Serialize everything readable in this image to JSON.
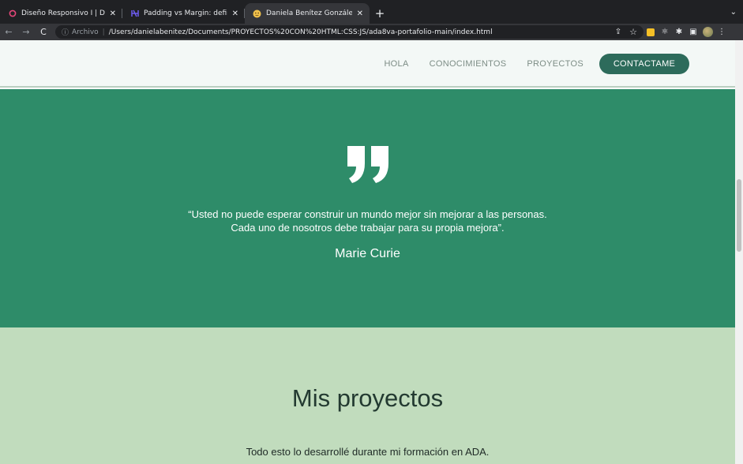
{
  "browser": {
    "tabs": [
      {
        "title": "Diseño Responsivo I | Desarroll",
        "favicon": "ring-icon",
        "color": "#e8477a"
      },
      {
        "title": "Padding vs Margin: definición,",
        "favicon": "h-logo-icon",
        "color": "#6d5cf0"
      },
      {
        "title": "Daniela Benítez González",
        "favicon": "emoji-icon",
        "color": "#f0c14b"
      }
    ],
    "new_tab": "+",
    "address": {
      "scheme": "Archivo",
      "url": "/Users/danielabenitez/Documents/PROYECTOS%20CON%20HTML:CSS:JS/ada8va-portafolio-main/index.html"
    }
  },
  "site": {
    "nav": {
      "links": [
        "HOLA",
        "CONOCIMIENTOS",
        "PROYECTOS"
      ],
      "cta": "CONTACTAME"
    },
    "quote": {
      "line1": "“Usted no puede esperar construir un mundo mejor sin mejorar a las personas.",
      "line2": "Cada uno de nosotros debe trabajar para su propia mejora”.",
      "author": "Marie Curie"
    },
    "projects": {
      "title": "Mis proyectos",
      "subtitle": "Todo esto lo desarrollé durante mi formación en ADA."
    }
  },
  "colors": {
    "header_bg": "#f3f8f6",
    "cta_bg": "#2d6b5b",
    "quote_bg": "#2e8c69",
    "projects_bg": "#c1dcbd"
  }
}
